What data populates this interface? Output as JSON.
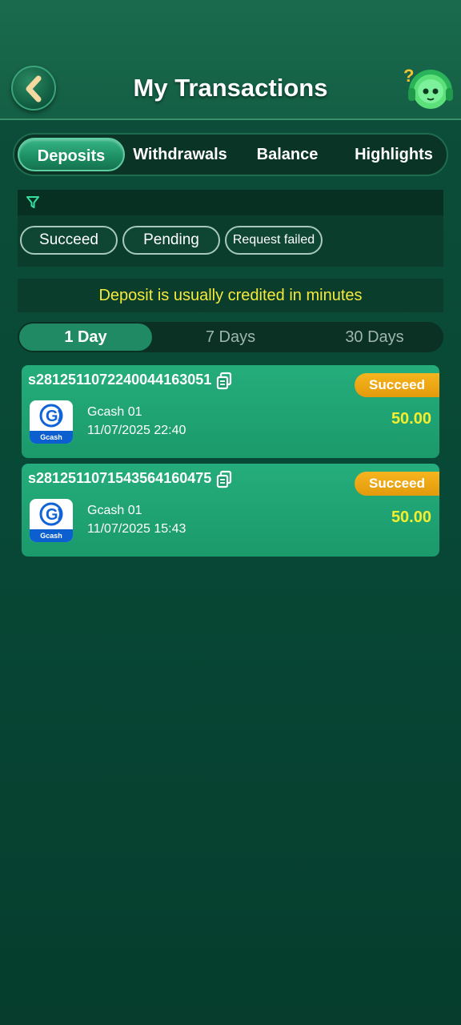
{
  "header": {
    "title": "My Transactions"
  },
  "tabs": [
    "Deposits",
    "Withdrawals",
    "Balance",
    "Highlights"
  ],
  "filters": {
    "chips": [
      "Succeed",
      "Pending",
      "Request failed"
    ]
  },
  "notice": "Deposit is usually credited in minutes",
  "ranges": [
    "1 Day",
    "7 Days",
    "30 Days"
  ],
  "transactions": [
    {
      "id": "s2812511072240044163051",
      "status": "Succeed",
      "method": "Gcash 01",
      "datetime": "11/07/2025 22:40",
      "amount": "50.00",
      "logo_text": "Gcash"
    },
    {
      "id": "s2812511071543564160475",
      "status": "Succeed",
      "method": "Gcash 01",
      "datetime": "11/07/2025 15:43",
      "amount": "50.00",
      "logo_text": "Gcash"
    }
  ],
  "colors": {
    "accent": "#1f8a63",
    "notice_text": "#f4ea3a",
    "amount_text": "#f4ee2e",
    "badge": "#f0a818"
  },
  "icons": [
    "back-arrow-icon",
    "support-mascot-icon",
    "filter-icon",
    "copy-icon",
    "gcash-logo-icon"
  ]
}
